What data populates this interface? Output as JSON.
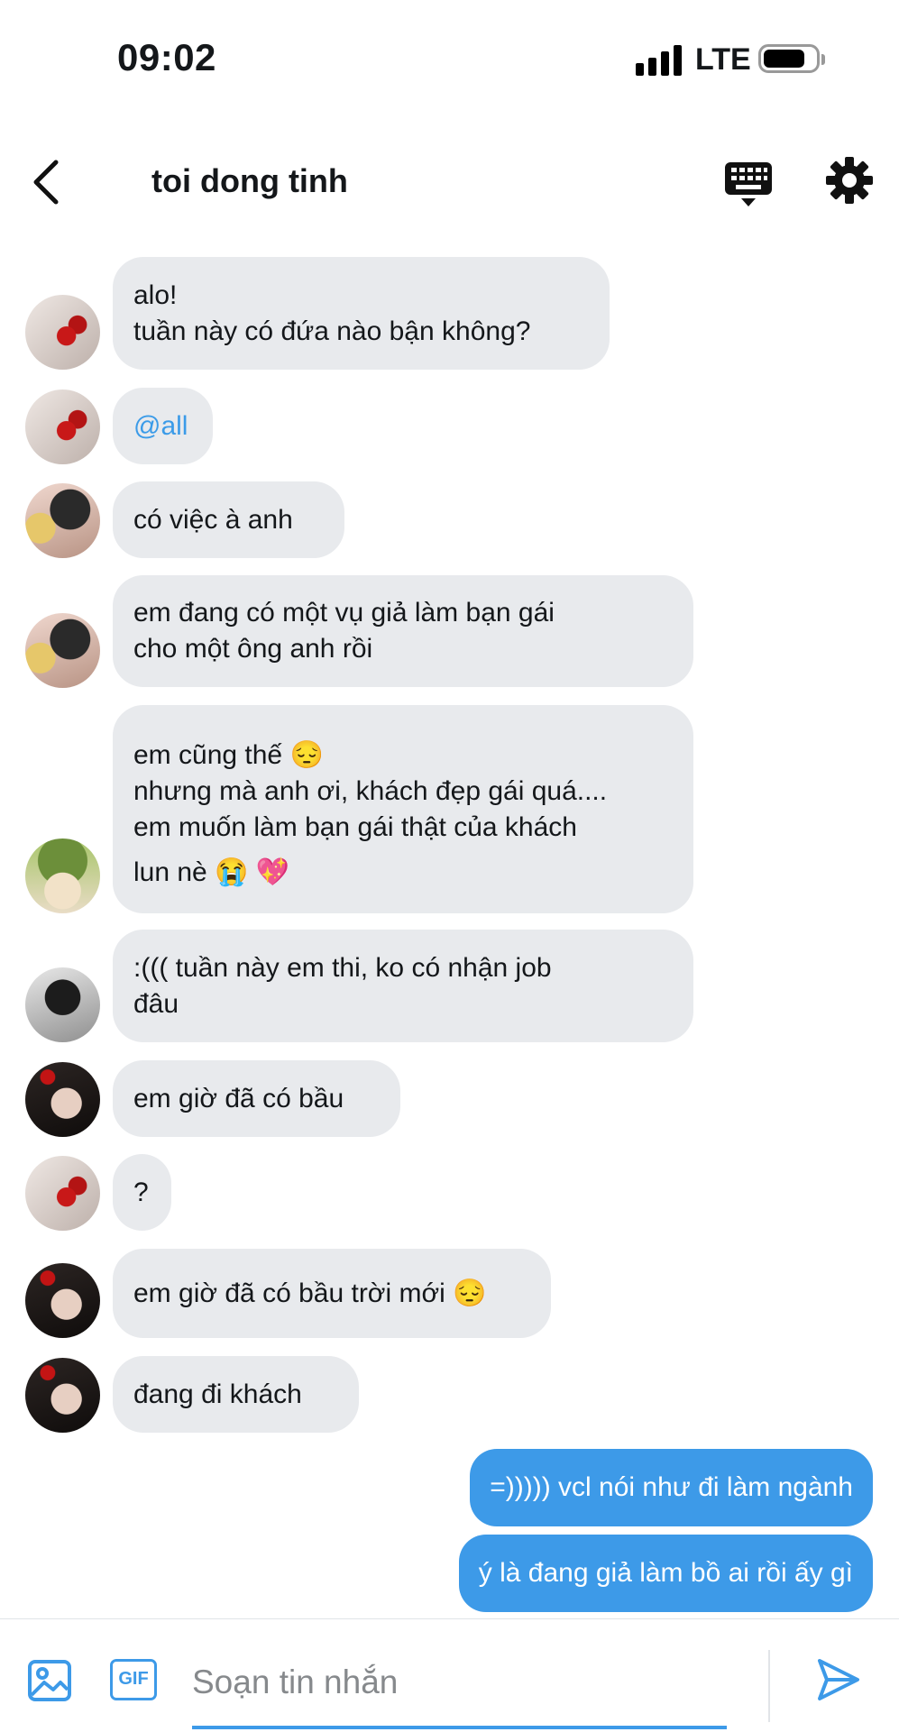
{
  "status_bar": {
    "time": "09:02",
    "network": "LTE"
  },
  "header": {
    "title": "toi dong tinh"
  },
  "messages": [
    {
      "lines": [
        "alo!",
        "tuần này có đứa nào bận không?"
      ]
    },
    {
      "lines": [
        "@all"
      ]
    },
    {
      "lines": [
        "có việc à anh"
      ]
    },
    {
      "lines": [
        "em đang có một vụ giả làm bạn gái",
        "cho một ông anh rồi"
      ]
    },
    {
      "lines": [
        "em cũng thế 😔",
        "nhưng mà anh ơi, khách đẹp gái quá....",
        "em muốn làm bạn gái thật của khách",
        "lun nè 😭 💖"
      ]
    },
    {
      "lines": [
        ":((( tuần này em thi, ko có nhận job",
        "đâu"
      ]
    },
    {
      "lines": [
        "em giờ đã có bầu"
      ]
    },
    {
      "lines": [
        "?"
      ]
    },
    {
      "lines": [
        "em giờ đã có bầu trời mới 😔"
      ]
    },
    {
      "lines": [
        "đang đi khách"
      ]
    }
  ],
  "outgoing": [
    {
      "text": "=))))) vcl nói như đi làm ngành"
    },
    {
      "text": "ý là đang giả làm bồ ai rồi ấy gì"
    }
  ],
  "composer": {
    "placeholder": "Soạn tin nhắn",
    "gif_label": "GIF"
  },
  "colors": {
    "accent": "#3d9ae8",
    "incoming_bubble": "#e8eaed",
    "mention": "#3b9be8"
  }
}
